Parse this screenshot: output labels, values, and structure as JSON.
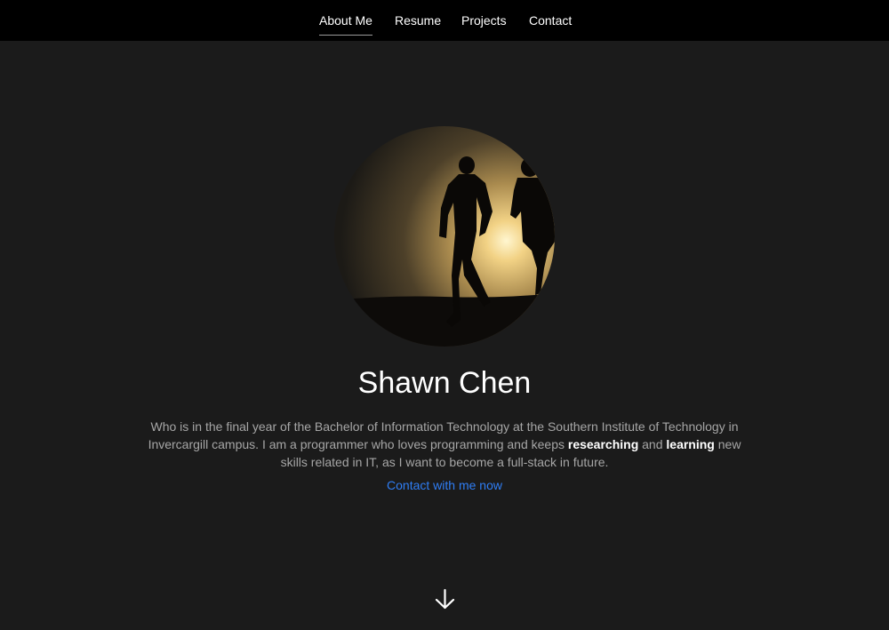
{
  "nav": {
    "items": [
      {
        "label": "About Me",
        "active": true
      },
      {
        "label": "Resume",
        "active": false
      },
      {
        "label": "Projects",
        "active": false
      },
      {
        "label": "Contact",
        "active": false
      }
    ]
  },
  "hero": {
    "photo_icon": "runners-silhouette-photo",
    "name": "Shawn Chen",
    "bio": {
      "part1": "Who is in the final year of the Bachelor of Information Technology at the Southern Institute of Technology in Invercargill campus. I am a programmer who loves programming and keeps ",
      "bold1": "researching",
      "part2": " and ",
      "bold2": "learning",
      "part3": " new skills related in IT, as I want to become a full-stack in future."
    },
    "contact_link": "Contact with me now",
    "scroll_icon": "arrow-down-icon"
  },
  "colors": {
    "background": "#1b1b1b",
    "nav_background": "#000000",
    "link": "#2f7ef5",
    "body_text": "#a6a6a6",
    "heading": "#ffffff"
  }
}
